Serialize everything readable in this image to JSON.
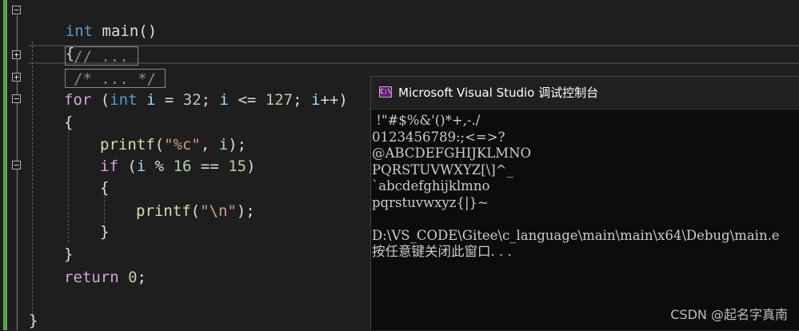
{
  "editor": {
    "lines": {
      "l1": {
        "kw": "int",
        "rest": " main()"
      },
      "l2": {
        "text": "{"
      },
      "l3": {
        "text": "// ..."
      },
      "l4": {
        "text": "/* ... */"
      },
      "l5": {
        "kw": "for",
        "p1": " (",
        "kw2": "int",
        "v1": " i",
        "p2": " = ",
        "n1": "32",
        "p3": "; ",
        "v2": "i",
        "p4": " <= ",
        "n2": "127",
        "p5": "; ",
        "v3": "i",
        "p6": "++)"
      },
      "l6": {
        "text": "{"
      },
      "l7": {
        "fn": "printf",
        "p1": "(",
        "str": "\"%c\"",
        "p2": ", ",
        "v": "i",
        "p3": ");"
      },
      "l8": {
        "kw": "if",
        "p1": " (",
        "v": "i",
        "p2": " % ",
        "n1": "16",
        "p3": " == ",
        "n2": "15",
        "p4": ")"
      },
      "l9": {
        "text": "{"
      },
      "l10": {
        "fn": "printf",
        "p1": "(",
        "str": "\"\\n\"",
        "p2": ");"
      },
      "l11": {
        "text": "}"
      },
      "l12": {
        "text": "}"
      },
      "l13": {
        "kw": "return",
        "p1": " ",
        "n": "0",
        "p2": ";"
      },
      "l14": {
        "text": "}"
      }
    }
  },
  "console": {
    "title": "Microsoft Visual Studio 调试控制台",
    "output": [
      " !\"#$%&'()*+,-./",
      "0123456789:;<=>?",
      "@ABCDEFGHIJKLMNO",
      "PQRSTUVWXYZ[\\]^_",
      "`abcdefghijklmno",
      "pqrstuvwxyz{|}~",
      "",
      "D:\\VS_CODE\\Gitee\\c_language\\main\\main\\x64\\Debug\\main.e",
      "按任意键关闭此窗口. . ."
    ]
  },
  "watermark": "CSDN @起名字真南"
}
